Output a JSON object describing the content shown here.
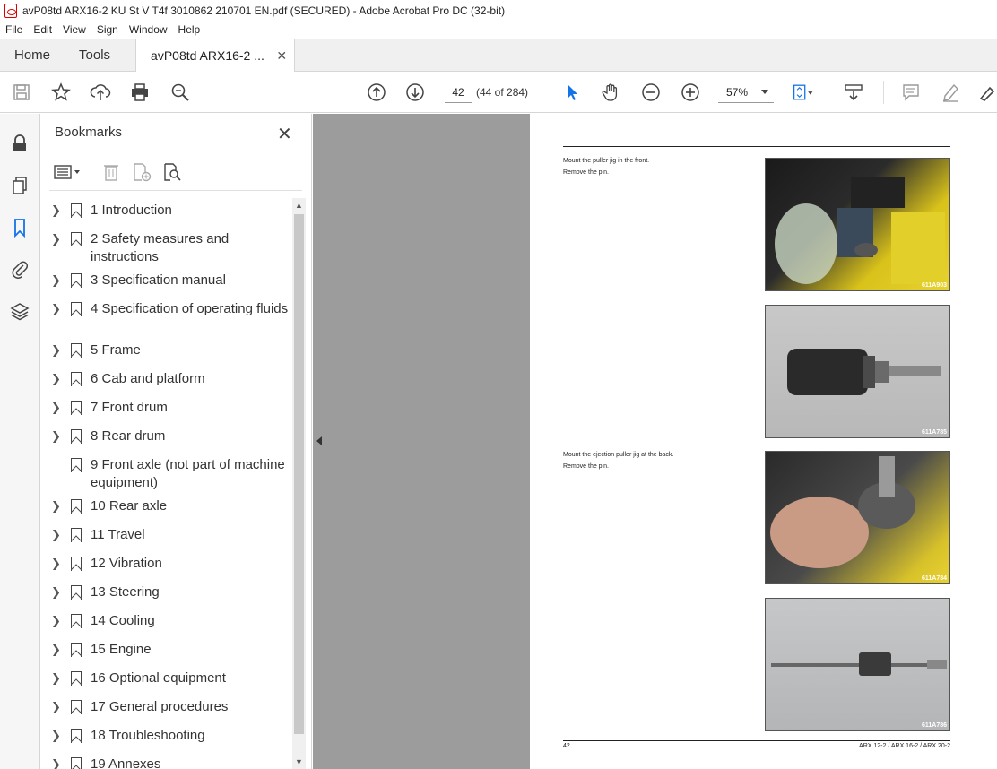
{
  "window": {
    "title": "avP08td ARX16-2 KU St V T4f 3010862 210701 EN.pdf (SECURED) - Adobe Acrobat Pro DC (32-bit)"
  },
  "menu": [
    "File",
    "Edit",
    "View",
    "Sign",
    "Window",
    "Help"
  ],
  "tabs": {
    "home": "Home",
    "tools": "Tools",
    "document": "avP08td ARX16-2 ..."
  },
  "toolbar": {
    "page_number": "42",
    "page_count": "(44 of 284)",
    "zoom": "57%"
  },
  "bookmarks": {
    "title": "Bookmarks",
    "items": [
      {
        "label": "1 Introduction",
        "expandable": true
      },
      {
        "label": "2 Safety measures and instructions",
        "expandable": true
      },
      {
        "label": "3 Specification manual",
        "expandable": true
      },
      {
        "label": "4 Specification of operating fluids",
        "expandable": true
      },
      {
        "label": "5 Frame",
        "expandable": true
      },
      {
        "label": "6 Cab and platform",
        "expandable": true
      },
      {
        "label": "7 Front drum",
        "expandable": true
      },
      {
        "label": "8 Rear drum",
        "expandable": true
      },
      {
        "label": "9 Front axle (not part of machine equipment)",
        "expandable": false
      },
      {
        "label": "10 Rear axle",
        "expandable": true
      },
      {
        "label": "11 Travel",
        "expandable": true
      },
      {
        "label": "12 Vibration",
        "expandable": true
      },
      {
        "label": "13 Steering",
        "expandable": true
      },
      {
        "label": "14 Cooling",
        "expandable": true
      },
      {
        "label": "15 Engine",
        "expandable": true
      },
      {
        "label": "16 Optional equipment",
        "expandable": true
      },
      {
        "label": "17 General procedures",
        "expandable": true
      },
      {
        "label": "18 Troubleshooting",
        "expandable": true
      },
      {
        "label": "19 Annexes",
        "expandable": true
      }
    ]
  },
  "page": {
    "step1_line1": "Mount the puller jig in the front.",
    "step1_line2": "Remove the pin.",
    "step2_line1": "Mount the ejection puller jig at the back.",
    "step2_line2": "Remove the pin.",
    "images": [
      "611A903",
      "611A785",
      "611A784",
      "611A786"
    ],
    "footer_left": "42",
    "footer_right": "ARX 12-2 / ARX 16-2 / ARX 20-2"
  },
  "colors": {
    "accent": "#1473e6",
    "viewer_bg": "#9c9c9c"
  }
}
